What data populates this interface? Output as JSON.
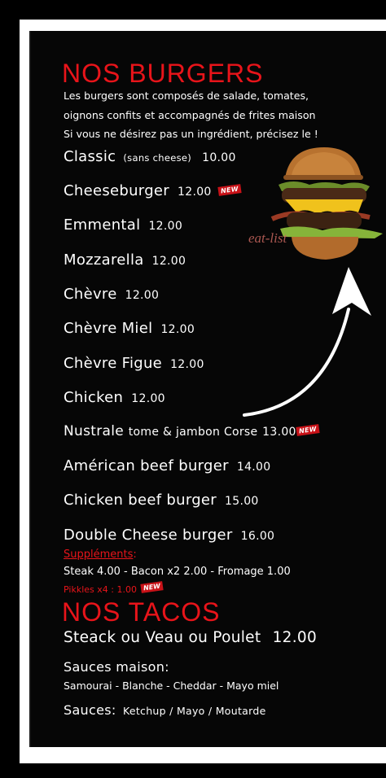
{
  "burgers": {
    "title": "NOS BURGERS",
    "intro": [
      "Les burgers sont composés de salade, tomates,",
      "oignons confits et accompagnés de frites maison",
      "Si vous ne désirez pas un ingrédient, précisez le !"
    ],
    "items": [
      {
        "name": "Classic",
        "note": "(sans cheese)",
        "price": "10.00",
        "badge": ""
      },
      {
        "name": "Cheeseburger",
        "note": "",
        "price": "12.00",
        "badge": "NEW"
      },
      {
        "name": "Emmental",
        "note": "",
        "price": "12.00",
        "badge": ""
      },
      {
        "name": "Mozzarella",
        "note": "",
        "price": "12.00",
        "badge": ""
      },
      {
        "name": "Chèvre",
        "note": "",
        "price": "12.00",
        "badge": ""
      },
      {
        "name": "Chèvre Miel",
        "note": "",
        "price": "12.00",
        "badge": ""
      },
      {
        "name": "Chèvre Figue",
        "note": "",
        "price": "12.00",
        "badge": ""
      },
      {
        "name": "Chicken",
        "note": "",
        "price": "12.00",
        "badge": ""
      },
      {
        "name": "Nustrale",
        "note": "tome & jambon Corse",
        "price": "13.00",
        "badge": "NEW"
      },
      {
        "name": "Américan beef burger",
        "note": "",
        "price": "14.00",
        "badge": ""
      },
      {
        "name": "Chicken beef burger",
        "note": "",
        "price": "15.00",
        "badge": ""
      },
      {
        "name": "Double Cheese burger",
        "note": "",
        "price": "16.00",
        "badge": ""
      }
    ],
    "supplements_title": "Suppléments",
    "supplements_colon": ":",
    "supplements_text": "Steak 4.00 - Bacon x2 2.00 - Fromage 1.00",
    "pikkles_text": "Pikkles x4 : 1.00",
    "pikkles_badge": "NEW",
    "watermark": "eat-list"
  },
  "tacos": {
    "title": "NOS TACOS",
    "item": "Steack ou Veau ou Poulet",
    "price": "12.00",
    "sauces_maison_label": "Sauces maison:",
    "sauces_maison_list": "Samourai - Blanche - Cheddar - Mayo miel",
    "sauces_label": "Sauces:",
    "sauces_list": "Ketchup / Mayo / Moutarde"
  },
  "colors": {
    "accent": "#e8141a",
    "background": "#060606",
    "frame": "#ffffff"
  },
  "icons": {
    "burger": "burger-photo-icon",
    "arrow": "curved-arrow-icon"
  }
}
